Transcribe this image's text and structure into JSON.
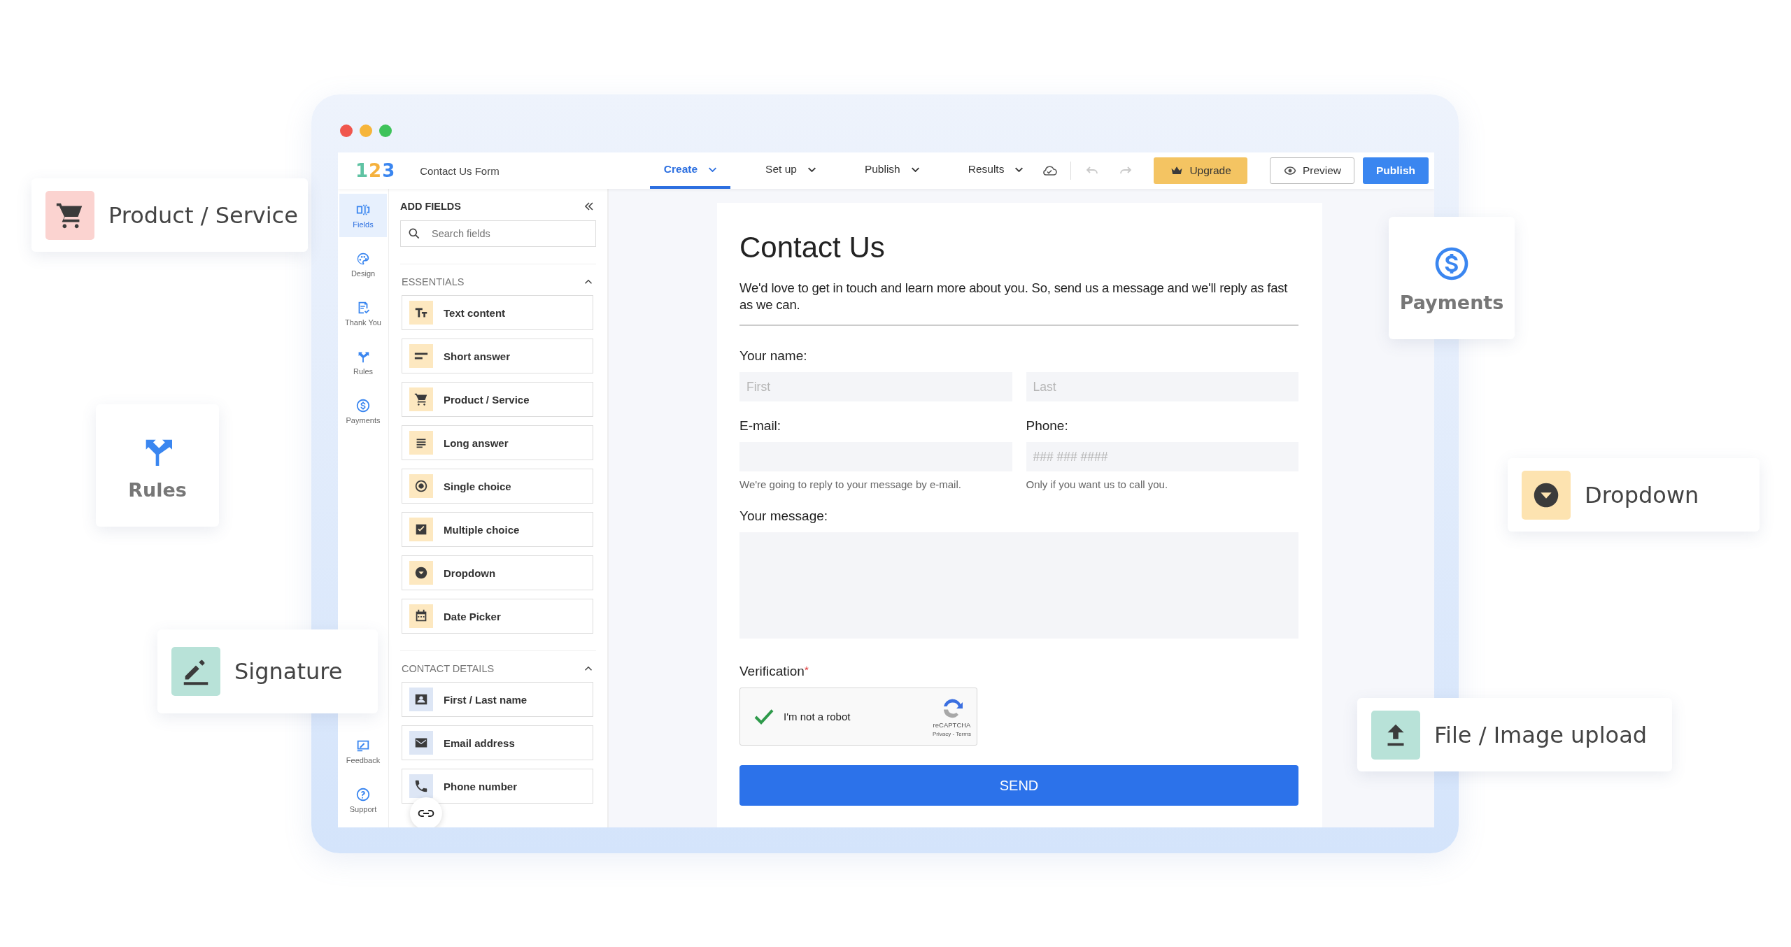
{
  "app": {
    "logo": "123",
    "form_name": "Contact Us Form",
    "tabs": [
      {
        "label": "Create",
        "selected": true
      },
      {
        "label": "Set up",
        "selected": false
      },
      {
        "label": "Publish",
        "selected": false
      },
      {
        "label": "Results",
        "selected": false
      }
    ],
    "actions": [
      {
        "kind": "upgrade",
        "label": "Upgrade"
      },
      {
        "kind": "preview",
        "label": "Preview"
      },
      {
        "kind": "publish",
        "label": "Publish"
      }
    ]
  },
  "rail": {
    "top": [
      {
        "kind": "fields",
        "label": "Fields",
        "selected": true
      },
      {
        "kind": "design",
        "label": "Design",
        "selected": false
      },
      {
        "kind": "thankyou",
        "label": "Thank You",
        "selected": false
      },
      {
        "kind": "rules",
        "label": "Rules",
        "selected": false
      },
      {
        "kind": "payments",
        "label": "Payments",
        "selected": false
      }
    ],
    "bottom": [
      {
        "kind": "feedback",
        "label": "Feedback",
        "selected": false
      },
      {
        "kind": "support",
        "label": "Support",
        "selected": false
      }
    ]
  },
  "panel": {
    "title": "ADD FIELDS",
    "search": {
      "placeholder": "Search fields"
    },
    "sections": [
      {
        "title": "ESSENTIALS",
        "expanded": true,
        "items": [
          {
            "kind": "text",
            "label": "Text content"
          },
          {
            "kind": "short",
            "label": "Short answer"
          },
          {
            "kind": "cart",
            "label": "Product / Service"
          },
          {
            "kind": "long",
            "label": "Long answer"
          },
          {
            "kind": "single",
            "label": "Single choice"
          },
          {
            "kind": "multi",
            "label": "Multiple choice"
          },
          {
            "kind": "dropdown",
            "label": "Dropdown"
          },
          {
            "kind": "date",
            "label": "Date Picker"
          }
        ]
      },
      {
        "title": "CONTACT DETAILS",
        "expanded": true,
        "items": [
          {
            "kind": "person",
            "label": "First / Last name"
          },
          {
            "kind": "email",
            "label": "Email address"
          },
          {
            "kind": "phone",
            "label": "Phone number"
          }
        ]
      }
    ]
  },
  "form": {
    "title": "Contact Us",
    "description": "We'd love to get in touch and learn more about you. So, send us a message and we'll reply as fast as we can.",
    "name_label": "Your name:",
    "first": {
      "placeholder": "First"
    },
    "last": {
      "placeholder": "Last"
    },
    "email_label": "E-mail:",
    "email_help": "We're going to reply to your message by e-mail.",
    "phone_label": "Phone:",
    "phone": {
      "placeholder": "### ### ####"
    },
    "phone_help": "Only if you want us to call you.",
    "message_label": "Your message:",
    "verification_label": "Verification",
    "verification_required": true,
    "required_mark": "*",
    "captcha": {
      "label": "I'm not a robot",
      "checked": true,
      "brand": "reCAPTCHA",
      "links": "Privacy - Terms"
    },
    "submit": "SEND"
  },
  "features": [
    {
      "kind": "product",
      "label": "Product / Service"
    },
    {
      "kind": "rules",
      "label": "Rules"
    },
    {
      "kind": "signature",
      "label": "Signature"
    },
    {
      "kind": "payments",
      "label": "Payments"
    },
    {
      "kind": "dropdown",
      "label": "Dropdown"
    },
    {
      "kind": "upload",
      "label": "File / Image upload"
    }
  ]
}
